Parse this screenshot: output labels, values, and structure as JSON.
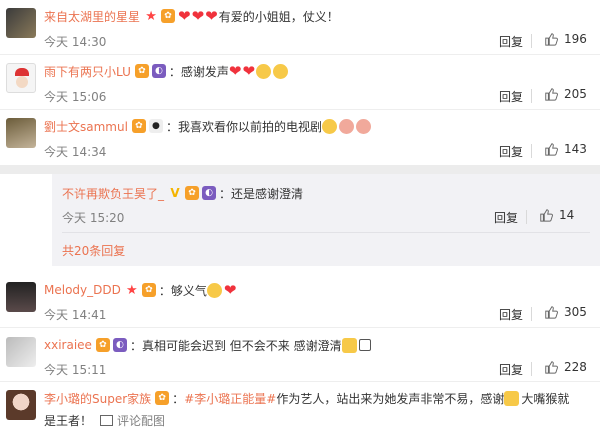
{
  "top_comments": [
    {
      "user": "来自太湖里的星星",
      "text": "有爱的小姐姐，仗义！",
      "time": "今天 14:30",
      "reply": "回复",
      "likes": "196"
    },
    {
      "user": "雨下有两只小LU",
      "text": "：感谢发声",
      "time": "今天 15:06",
      "reply": "回复",
      "likes": "205"
    },
    {
      "user": "劉士文sammul",
      "text": "：我喜欢看你以前拍的电视剧",
      "time": "今天 14:34",
      "reply": "回复",
      "likes": "143"
    }
  ],
  "nested": {
    "reply": {
      "user": "不许再欺负王昊了_",
      "text": "：还是感谢澄清",
      "time": "今天 15:20",
      "reply": "回复",
      "likes": "14"
    },
    "more_replies": "共20条回复"
  },
  "bottom_comments": [
    {
      "user": "Melody_DDD",
      "text": "：够义气",
      "time": "今天 14:41",
      "reply": "回复",
      "likes": "305"
    },
    {
      "user": "xxiraiee",
      "text": "：真相可能会迟到 但不会不来 感谢澄清",
      "time": "今天 15:11",
      "reply": "回复",
      "likes": "228"
    },
    {
      "user": "李小璐的Super家族",
      "hashtag": "#李小璐正能量#",
      "text": " 作为艺人，站出来为她发声非常不易，感谢",
      "text2": "大嘴猴就",
      "line2": "是王者！",
      "action": "评论配图"
    }
  ],
  "colors": {
    "name": "#eb7350",
    "time": "#808080",
    "gap": "#ececec",
    "nested_bg": "#f2f2f5"
  }
}
